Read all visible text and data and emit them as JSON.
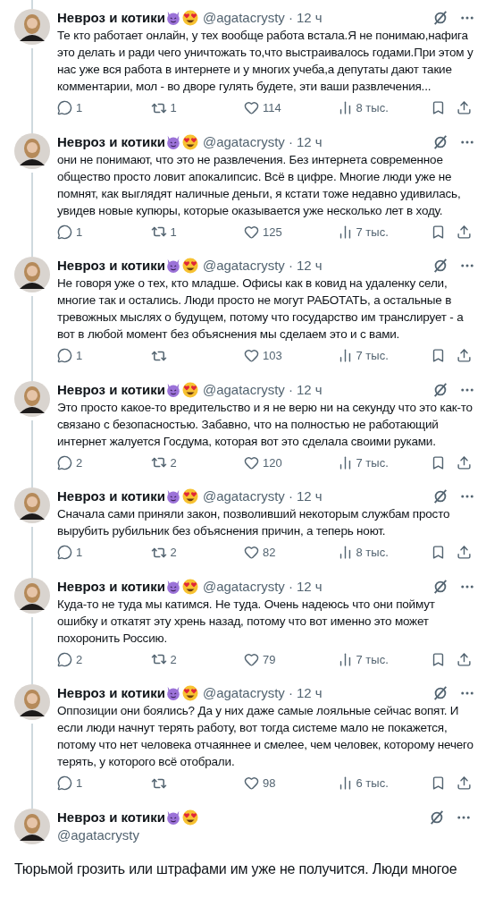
{
  "separator": "·",
  "tweets": [
    {
      "kind": "reply",
      "name": "Невроз и котики",
      "handle": "@agatacrysty",
      "time": "12 ч",
      "text": "Те кто работает онлайн, у тех вообще работа встала.Я не понимаю,нафига это делать и ради чего уничтожать то,что выстраивалось годами.При этом у нас уже вся работа в интернете и у многих учеба,а депутаты дают такие комментарии, мол - во дворе гулять будете, эти ваши развлечения...",
      "replies": "1",
      "reposts": "1",
      "likes": "114",
      "views": "8 тыс."
    },
    {
      "kind": "reply",
      "name": "Невроз и котики",
      "handle": "@agatacrysty",
      "time": "12 ч",
      "text": "они не понимают, что это не развлечения. Без интернета современное общество просто ловит апокалипсис. Всё в цифре. Многие люди уже не помнят, как выглядят наличные деньги, я кстати тоже недавно удивилась, увидев новые купюры, которые оказывается уже несколько лет в ходу.",
      "replies": "1",
      "reposts": "1",
      "likes": "125",
      "views": "7 тыс."
    },
    {
      "kind": "reply",
      "name": "Невроз и котики",
      "handle": "@agatacrysty",
      "time": "12 ч",
      "text": "Не говоря уже о тех, кто младше. Офисы как в ковид на удаленку сели, многие так и остались. Люди просто не могут РАБОТАТЬ, а остальные в тревожных мыслях о будущем, потому что государство им транслирует - а вот в любой момент без объяснения мы сделаем это и с вами.",
      "replies": "1",
      "likes": "103",
      "views": "7 тыс."
    },
    {
      "kind": "reply",
      "name": "Невроз и котики",
      "handle": "@agatacrysty",
      "time": "12 ч",
      "text": "Это просто какое-то вредительство и я не верю ни на секунду что это как-то связано с безопасностью. Забавно, что на полностью не работающий интернет жалуется Госдума, которая вот это сделала своими руками.",
      "replies": "2",
      "reposts": "2",
      "likes": "120",
      "views": "7 тыс."
    },
    {
      "kind": "reply",
      "name": "Невроз и котики",
      "handle": "@agatacrysty",
      "time": "12 ч",
      "text": "Сначала сами приняли закон, позволивший некоторым службам просто вырубить рубильник без объяснения причин, а теперь ноют.",
      "replies": "1",
      "reposts": "2",
      "likes": "82",
      "views": "8 тыс."
    },
    {
      "kind": "reply",
      "name": "Невроз и котики",
      "handle": "@agatacrysty",
      "time": "12 ч",
      "text": "Куда-то не туда мы катимся. Не туда. Очень надеюсь что они поймут ошибку и откатят эту хрень назад, потому что вот именно это может похоронить Россию.",
      "replies": "2",
      "reposts": "2",
      "likes": "79",
      "views": "7 тыс."
    },
    {
      "kind": "reply",
      "name": "Невроз и котики",
      "handle": "@agatacrysty",
      "time": "12 ч",
      "text": "Оппозиции они боялись? Да у них даже самые лояльные сейчас вопят. И если люди начнут терять работу, вот тогда системе мало не покажется, потому что нет человека отчаяннее и смелее, чем человек, которому нечего терять, у которого всё отобрали.",
      "replies": "1",
      "likes": "98",
      "views": "6 тыс."
    },
    {
      "kind": "main",
      "name": "Невроз и котики",
      "handle": "@agatacrysty",
      "text": "Тюрьмой грозить или штрафами им уже не получится. Люди многое"
    }
  ]
}
